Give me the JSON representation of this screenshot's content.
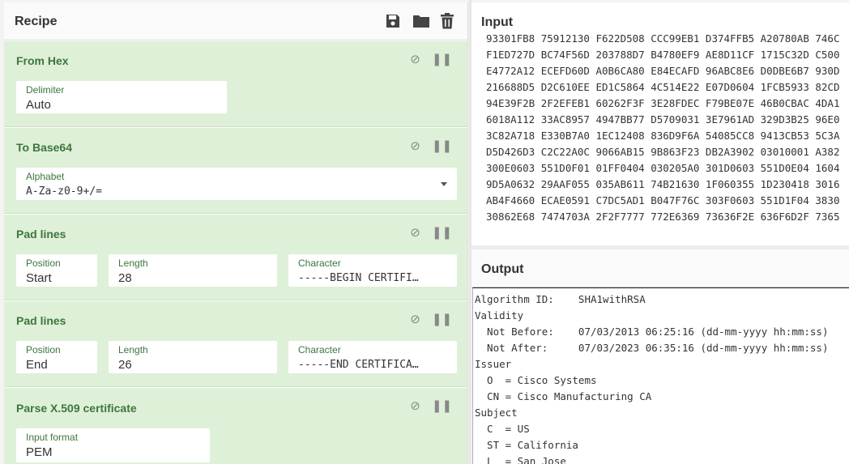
{
  "recipe": {
    "title": "Recipe",
    "icons": [
      "save-icon",
      "folder-icon",
      "trash-icon"
    ],
    "operations": [
      {
        "name": "From Hex",
        "fields": [
          {
            "label": "Delimiter",
            "value": "Auto"
          }
        ]
      },
      {
        "name": "To Base64",
        "fields": [
          {
            "label": "Alphabet",
            "value": "A-Za-z0-9+/="
          }
        ]
      },
      {
        "name": "Pad lines",
        "fields": [
          {
            "label": "Position",
            "value": "Start"
          },
          {
            "label": "Length",
            "value": "28"
          },
          {
            "label": "Character",
            "value": "-----BEGIN CERTIFI…"
          }
        ]
      },
      {
        "name": "Pad lines",
        "fields": [
          {
            "label": "Position",
            "value": "End"
          },
          {
            "label": "Length",
            "value": "26"
          },
          {
            "label": "Character",
            "value": "-----END CERTIFICA…"
          }
        ]
      },
      {
        "name": "Parse X.509 certificate",
        "fields": [
          {
            "label": "Input format",
            "value": "PEM"
          }
        ]
      }
    ]
  },
  "input": {
    "title": "Input",
    "lines": [
      "93301FB8 75912130 F622D508 CCC99EB1 D374FFB5 A20780AB 746C",
      "F1ED727D BC74F56D 203788D7 B4780EF9 AE8D11CF 1715C32D C500",
      "E4772A12 ECEFD60D A0B6CA80 E84ECAFD 96ABC8E6 D0DBE6B7 930D",
      "216688D5 D2C610EE ED1C5864 4C514E22 E07D0604 1FCB5933 82CD",
      "94E39F2B 2F2EFEB1 60262F3F 3E28FDEC F79BE07E 46B0CBAC 4DA1",
      "6018A112 33AC8957 4947BB77 D5709031 3E7961AD 329D3B25 96E0",
      "3C82A718 E330B7A0 1EC12408 836D9F6A 54085CC8 9413CB53 5C3A",
      "D5D426D3 C2C22A0C 9066AB15 9B863F23 DB2A3902 03010001 A382",
      "300E0603 551D0F01 01FF0404 030205A0 301D0603 551D0E04 1604",
      "9D5A0632 29AAF055 035AB611 74B21630 1F060355 1D230418 3016",
      "AB4F4660 ECAE0591 C7DC5AD1 B047F76C 303F0603 551D1F04 3830",
      "30862E68 7474703A 2F2F7777 772E6369 73636F2E 636F6D2F 7365"
    ]
  },
  "output": {
    "title": "Output",
    "lines": [
      "Algorithm ID:    SHA1withRSA",
      "Validity",
      "  Not Before:    07/03/2013 06:25:16 (dd-mm-yyyy hh:mm:ss)",
      "  Not After:     07/03/2023 06:35:16 (dd-mm-yyyy hh:mm:ss)",
      "Issuer",
      "  O  = Cisco Systems",
      "  CN = Cisco Manufacturing CA",
      "Subject",
      "  C  = US",
      "  ST = California",
      "  L  = San Jose"
    ]
  }
}
